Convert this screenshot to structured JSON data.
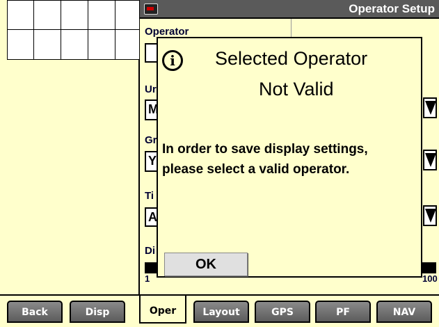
{
  "header": {
    "title": "Operator Setup",
    "icon": "display-icon"
  },
  "fields": {
    "operator": {
      "label": "Operator",
      "value": ""
    },
    "units": {
      "label": "Ur",
      "value": "M"
    },
    "group": {
      "label": "Gr",
      "value": "Y"
    },
    "time": {
      "label": "Ti",
      "value": "A"
    },
    "display": {
      "label": "Di",
      "scale_min": "1",
      "scale_max": "100"
    }
  },
  "dialog": {
    "icon": "info-icon",
    "icon_glyph": "i",
    "title_line1": "Selected Operator",
    "title_line2": "Not Valid",
    "message": "In order to save display settings, please select a valid operator.",
    "ok_label": "OK"
  },
  "tabs": [
    {
      "label": "Back",
      "active": false
    },
    {
      "label": "Disp",
      "active": false
    },
    {
      "label": "Oper",
      "active": true
    },
    {
      "label": "Layout",
      "active": false
    },
    {
      "label": "GPS",
      "active": false
    },
    {
      "label": "PF",
      "active": false
    },
    {
      "label": "NAV",
      "active": false
    }
  ],
  "colors": {
    "background": "#ffffcc",
    "header": "#5a5a5a",
    "tab": "#6e6e6e"
  }
}
